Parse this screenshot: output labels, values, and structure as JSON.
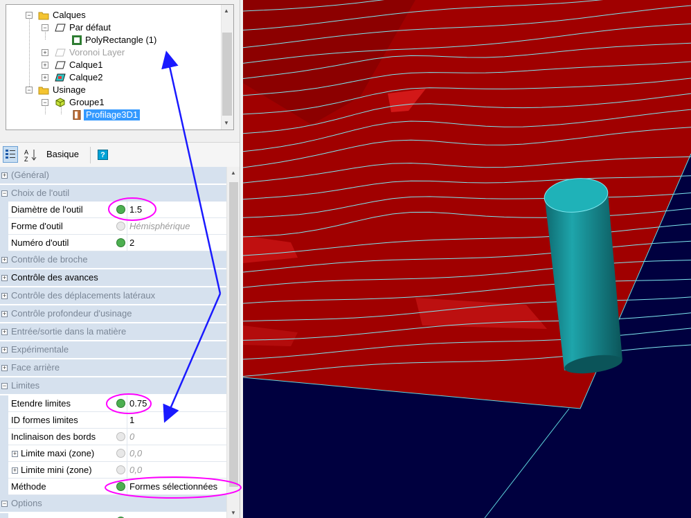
{
  "tree": {
    "items": [
      {
        "label": "Calques"
      },
      {
        "label": "Par défaut"
      },
      {
        "label": "PolyRectangle (1)"
      },
      {
        "label": "Voronoi Layer"
      },
      {
        "label": "Calque1"
      },
      {
        "label": "Calque2"
      },
      {
        "label": "Usinage"
      },
      {
        "label": "Groupe1"
      },
      {
        "label": "Profilage3D1"
      }
    ]
  },
  "toolbar": {
    "basic_label": "Basique"
  },
  "grid": {
    "rows": [
      {
        "type": "cat",
        "label": "(Général)"
      },
      {
        "type": "cat",
        "label": "Choix de l'outil"
      },
      {
        "type": "prop",
        "label": "Diamètre de l'outil",
        "value": "1.5"
      },
      {
        "type": "prop",
        "label": "Forme d'outil",
        "value": "Hémisphérique"
      },
      {
        "type": "prop",
        "label": "Numéro d'outil",
        "value": "2"
      },
      {
        "type": "cat",
        "label": "Contrôle de broche"
      },
      {
        "type": "cat",
        "label": "Contrôle des avances"
      },
      {
        "type": "cat",
        "label": "Contrôle des déplacements latéraux"
      },
      {
        "type": "cat",
        "label": "Contrôle profondeur d'usinage"
      },
      {
        "type": "cat",
        "label": "Entrée/sortie dans la matière"
      },
      {
        "type": "cat",
        "label": "Expérimentale"
      },
      {
        "type": "cat",
        "label": "Face arrière"
      },
      {
        "type": "cat",
        "label": "Limites"
      },
      {
        "type": "prop",
        "label": "Etendre limites",
        "value": "0.75"
      },
      {
        "type": "prop",
        "label": "ID formes limites",
        "value": "1"
      },
      {
        "type": "prop",
        "label": "Inclinaison des bords",
        "value": "0"
      },
      {
        "type": "prop",
        "label": "Limite maxi (zone)",
        "value": "0,0"
      },
      {
        "type": "prop",
        "label": "Limite mini (zone)",
        "value": "0,0"
      },
      {
        "type": "prop",
        "label": "Méthode",
        "value": "Formes sélectionnées"
      },
      {
        "type": "cat",
        "label": "Options"
      }
    ]
  },
  "colors": {
    "accent_highlight": "#ff00ff",
    "arrow": "#1a1aff",
    "surface": "#a00000",
    "contour": "#7fe8f0",
    "tool": "#1a9aa0",
    "background_3d": "#00003f"
  }
}
